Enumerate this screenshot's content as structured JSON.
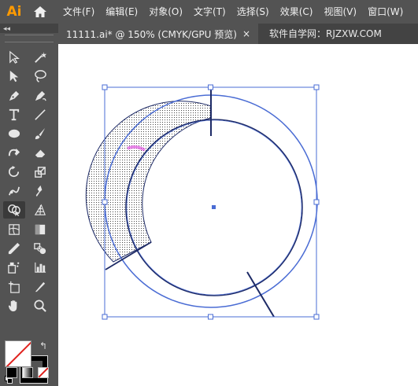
{
  "app": {
    "logo": "Ai"
  },
  "menu": [
    "文件(F)",
    "编辑(E)",
    "对象(O)",
    "文字(T)",
    "选择(S)",
    "效果(C)",
    "视图(V)",
    "窗口(W)"
  ],
  "document": {
    "tab_title": "11111.ai* @ 150% (CMYK/GPU 预览)",
    "close_glyph": "×",
    "watermark": "软件自学网：RJZXW.COM"
  },
  "toolbar": {
    "collapse_glyph": "◂◂",
    "swap_glyph": "↰",
    "tools": [
      "selection-tool",
      "magic-wand-tool",
      "direct-selection-tool",
      "lasso-tool",
      "pen-tool",
      "curvature-tool",
      "type-tool",
      "line-segment-tool",
      "ellipse-tool",
      "paintbrush-tool",
      "shaper-tool",
      "eraser-tool",
      "rotate-tool",
      "scale-tool",
      "puppet-warp-tool",
      "free-transform-tool",
      "shape-builder-tool",
      "perspective-grid-tool",
      "mesh-tool",
      "gradient-tool",
      "eyedropper-tool",
      "blend-tool",
      "symbol-sprayer-tool",
      "column-graph-tool",
      "artboard-tool",
      "slice-tool",
      "hand-tool",
      "zoom-tool"
    ],
    "active_tool": "shape-builder-tool"
  },
  "colors": {
    "fill": "#ffffff",
    "stroke": "#000000",
    "selection": "#4a6cd4",
    "path": "#1d2a66",
    "highlight": "#e040e0"
  }
}
